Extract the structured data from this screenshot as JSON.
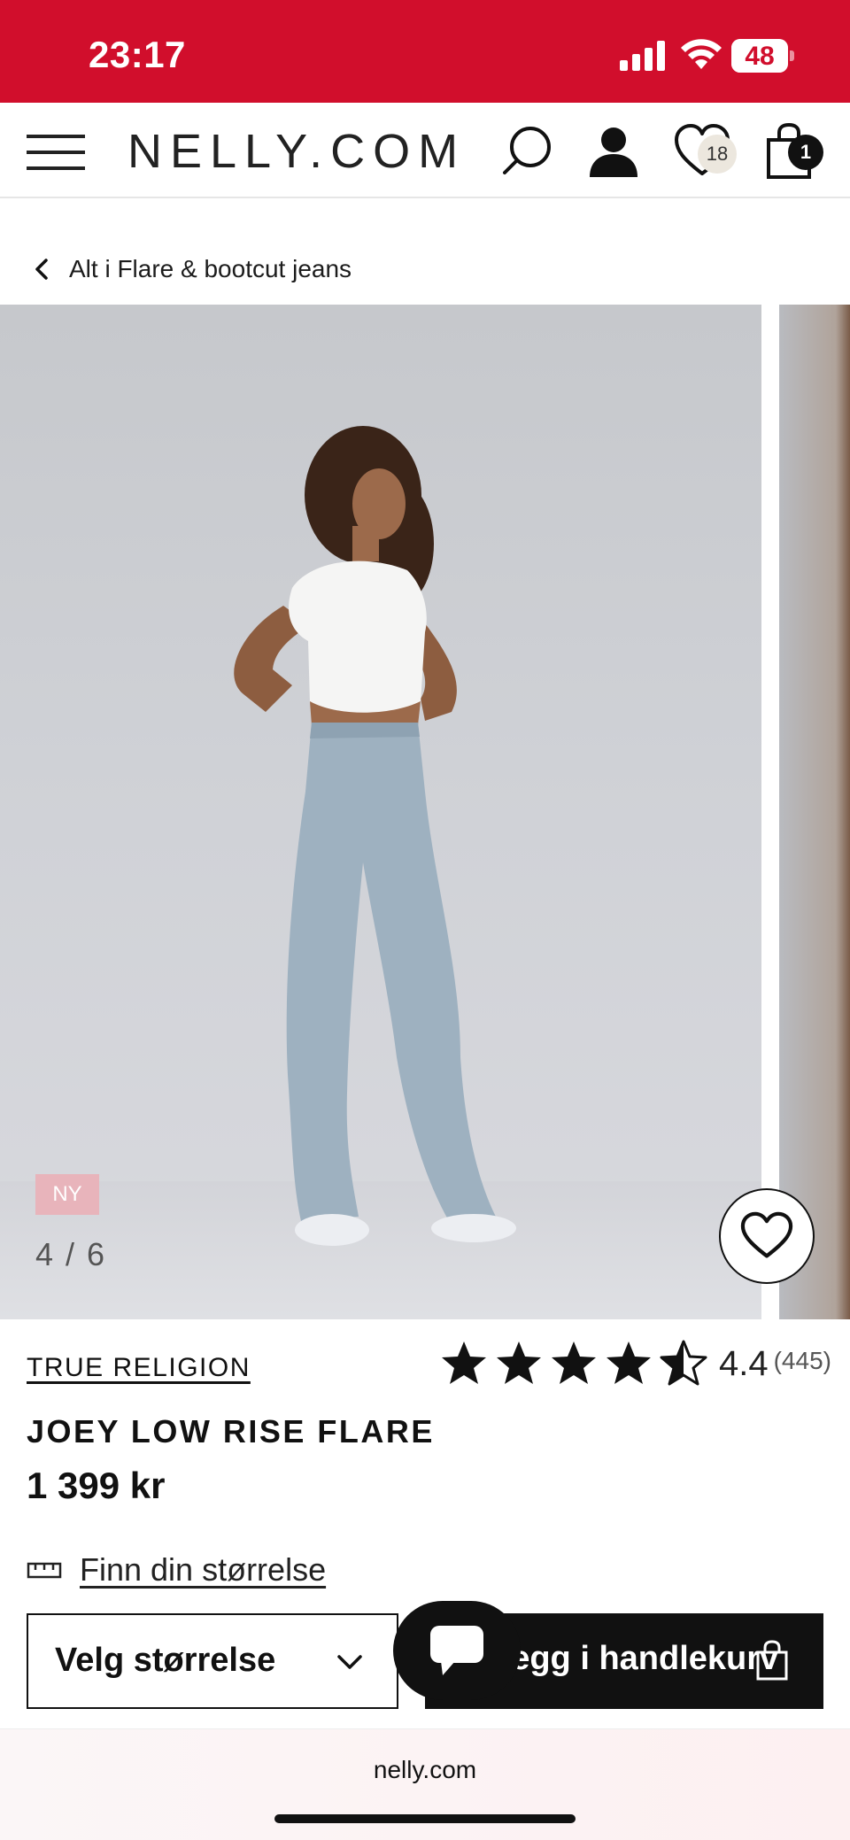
{
  "status_bar": {
    "time": "23:17",
    "battery_percent": "48"
  },
  "header": {
    "logo": "NELLY.COM",
    "wishlist_count": "18",
    "cart_count": "1"
  },
  "breadcrumb": {
    "label": "Alt i Flare & bootcut jeans"
  },
  "gallery": {
    "badge": "NY",
    "counter": "4 / 6",
    "current": 4,
    "total": 6
  },
  "product": {
    "brand": "TRUE RELIGION",
    "name": "JOEY LOW RISE FLARE",
    "price": "1 399 kr",
    "rating": {
      "value": 4.4,
      "score_label": "4.4",
      "count_label": "(445)",
      "max": 5
    }
  },
  "size_guide": {
    "label": "Finn din størrelse"
  },
  "actions": {
    "size_select_label": "Velg størrelse",
    "add_to_cart_label": "Legg i handlekurv"
  },
  "browser": {
    "url": "nelly.com"
  },
  "colors": {
    "status_bar": "#d10e2c",
    "new_badge": "#e8b4bb",
    "primary": "#111111"
  }
}
